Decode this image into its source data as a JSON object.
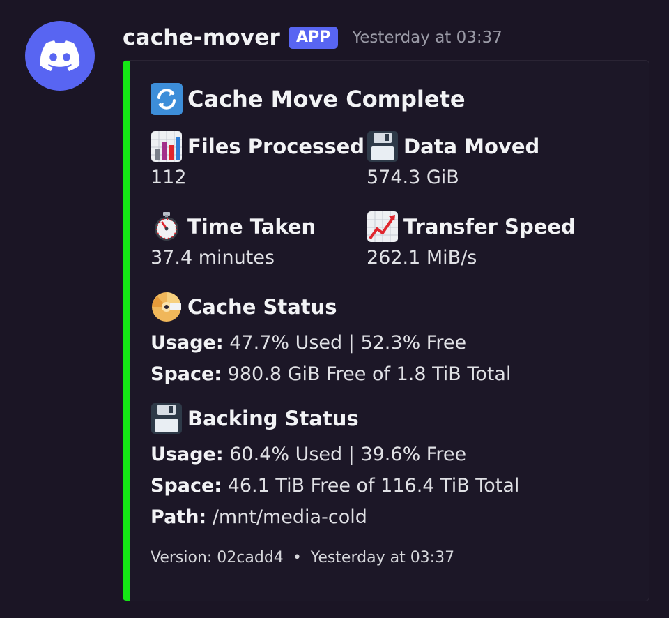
{
  "message": {
    "username": "cache-mover",
    "badge": "APP",
    "timestamp": "Yesterday at 03:37"
  },
  "embed": {
    "accent_color": "#15e615",
    "title": "Cache Move Complete",
    "title_icon": "arrows-cycle-icon",
    "fields": {
      "files_processed": {
        "name": "Files Processed",
        "value": "112",
        "icon": "bar-chart-icon"
      },
      "data_moved": {
        "name": "Data Moved",
        "value": "574.3 GiB",
        "icon": "floppy-disk-icon"
      },
      "time_taken": {
        "name": "Time Taken",
        "value": "37.4 minutes",
        "icon": "stopwatch-icon"
      },
      "transfer_speed": {
        "name": "Transfer Speed",
        "value": "262.1 MiB/s",
        "icon": "chart-increasing-icon"
      }
    },
    "cache_status": {
      "name": "Cache Status",
      "icon": "dvd-disc-icon",
      "usage_label": "Usage:",
      "usage_value": "47.7% Used | 52.3% Free",
      "space_label": "Space:",
      "space_value": "980.8 GiB Free of 1.8 TiB Total"
    },
    "backing_status": {
      "name": "Backing Status",
      "icon": "floppy-disk-icon",
      "usage_label": "Usage:",
      "usage_value": "60.4% Used | 39.6% Free",
      "space_label": "Space:",
      "space_value": "46.1 TiB Free of 116.4 TiB Total",
      "path_label": "Path:",
      "path_value": "/mnt/media-cold"
    },
    "footer": {
      "version": "Version: 02cadd4",
      "separator": "•",
      "timestamp": "Yesterday at 03:37"
    }
  }
}
